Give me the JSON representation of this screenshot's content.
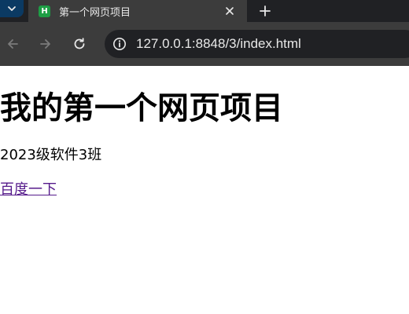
{
  "browser": {
    "tab": {
      "favicon_letter": "H",
      "title": "第一个网页项目",
      "favicon_color": "#1e9e45"
    },
    "new_tab_icon": "plus-icon",
    "address_bar": {
      "url": "127.0.0.1:8848/3/index.html",
      "site_info_icon": "info-icon"
    },
    "nav": {
      "back_icon": "arrow-left-icon",
      "forward_icon": "arrow-right-icon",
      "reload_icon": "reload-icon"
    }
  },
  "page": {
    "heading": "我的第一个网页项目",
    "subtitle": "2023级软件3班",
    "link_text": "百度一下",
    "link_color": "#551a8b"
  }
}
